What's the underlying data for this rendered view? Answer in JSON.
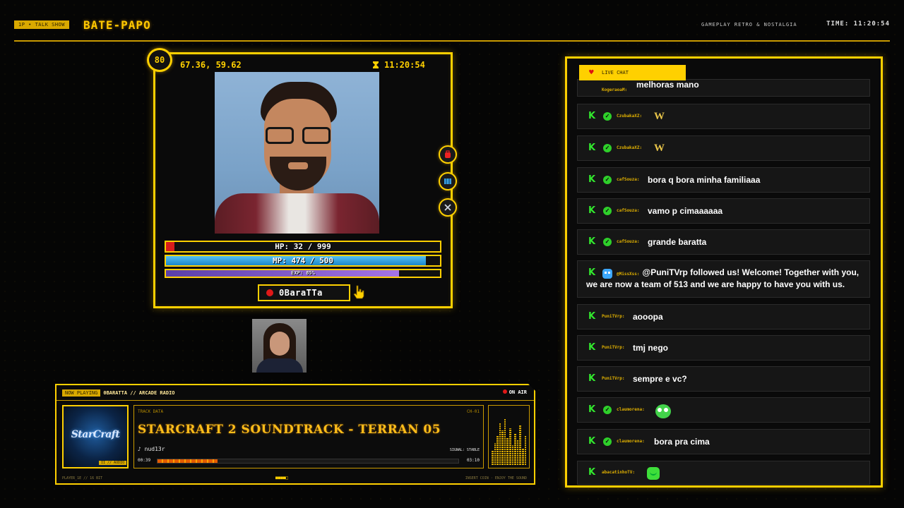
{
  "topbar": {
    "tag": "1P • TALK SHOW",
    "brand": "BATE-PAPO",
    "subtitle": "GAMEPLAY RETRO & NOSTALGIA",
    "time": "TIME: 11:20:54"
  },
  "card": {
    "level": "80",
    "coords": "67.36, 59.62",
    "time": "11:20:54",
    "hp_label": "HP: 32 / 999",
    "hp_fraction": 0.032,
    "mp_label": "MP: 474 / 500",
    "mp_fraction": 0.948,
    "exp_label": "EXP: 85%",
    "exp_fraction": 0.85,
    "player_name": "0BaraTTa",
    "side_buttons": [
      "backpack-icon",
      "map-icon",
      "swords-icon"
    ]
  },
  "player": {
    "now_playing": "NOW PLAYING",
    "station": "0BARATTA // ARCADE RADIO",
    "on_air": "ON AIR",
    "cover_logo": "StarCraft",
    "cover_tag": "II // AUDIO",
    "track_label": "TRACK DATA",
    "track_id": "CH-01",
    "title": "STARCRAFT 2 SOUNDTRACK - TERRAN 05",
    "artist": "♪ nud13r",
    "signal": "SIGNAL: STABLE",
    "elapsed": "00:39",
    "total": "03:10",
    "progress": 0.2,
    "footer_left": "PLAYER_1E // 16 BIT",
    "footer_mid": "■■■■□",
    "footer_right": "INSERT COIN · ENJOY THE SOUND",
    "accent": "#ffd000"
  },
  "chat": {
    "tab_label": "LIVE CHAT",
    "messages": [
      {
        "user": "KogeraoaM:",
        "text": "melhoras mano"
      },
      {
        "user": "CzubakaXZ:",
        "text": "W"
      },
      {
        "user": "CzubakaXZ:",
        "text": "W"
      },
      {
        "user": "cafSouza:",
        "text": "bora q bora minha familiaaa"
      },
      {
        "user": "cafSouza:",
        "text": "vamo p cimaaaaaa"
      },
      {
        "user": "cafSouza:",
        "text": "grande baratta"
      },
      {
        "user": "@MissXss:",
        "text": "@PuniTVrp followed us! Welcome! Together with you, we are now a team of 513 and we are happy to have you with us."
      },
      {
        "user": "PuniTVrp:",
        "text": "aooopa"
      },
      {
        "user": "PuniTVrp:",
        "text": "tmj nego"
      },
      {
        "user": "PuniTVrp:",
        "text": "sempre e vc?"
      },
      {
        "user": "claumorena:",
        "text": ""
      },
      {
        "user": "claumorena:",
        "text": "bora pra cima"
      },
      {
        "user": "abacatinhoTV:",
        "text": ""
      }
    ]
  }
}
